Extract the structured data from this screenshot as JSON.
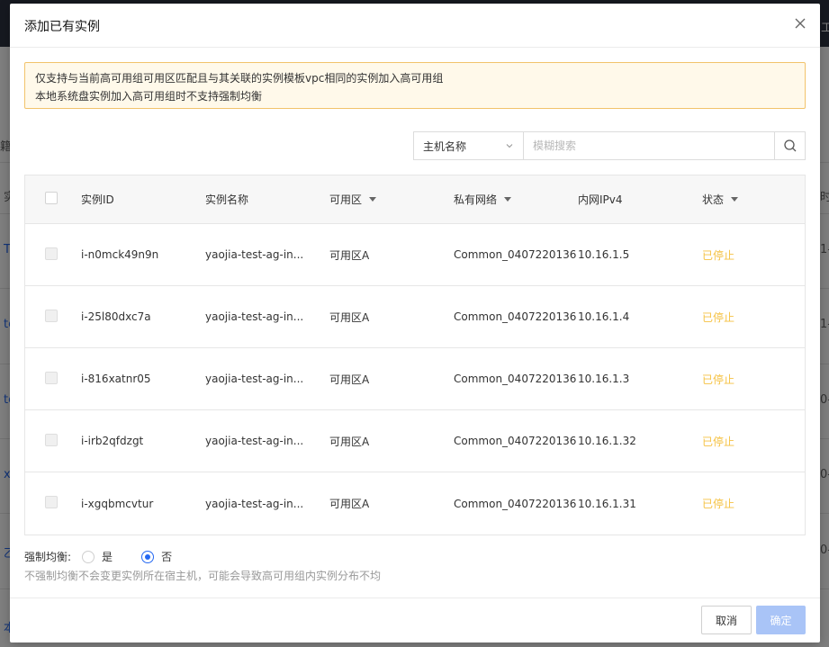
{
  "background": {
    "header_fragment": "工",
    "left_fragments": [
      "籍",
      "实",
      "T",
      "te",
      "te",
      "x",
      "乙",
      "本"
    ],
    "right_fragments": [
      "时",
      "1-",
      "1-",
      "0-",
      "0-",
      "0-"
    ]
  },
  "modal": {
    "title": "添加已有实例",
    "close_icon": "close-icon",
    "notice": [
      "仅支持与当前高可用组可用区匹配且与其关联的实例模板vpc相同的实例加入高可用组",
      "本地系统盘实例加入高可用组时不支持强制均衡"
    ],
    "search": {
      "select_value": "主机名称",
      "placeholder": "模糊搜索",
      "button_icon": "search-icon"
    },
    "table": {
      "columns": [
        "实例ID",
        "实例名称",
        "可用区",
        "私有网络",
        "内网IPv4",
        "状态"
      ],
      "rows": [
        {
          "id": "i-n0mck49n9n",
          "name": "yaojia-test-ag-in...",
          "zone": "可用区A",
          "vpc": "Common_0407220136",
          "ip": "10.16.1.5",
          "status": "已停止"
        },
        {
          "id": "i-25l80dxc7a",
          "name": "yaojia-test-ag-in...",
          "zone": "可用区A",
          "vpc": "Common_0407220136",
          "ip": "10.16.1.4",
          "status": "已停止"
        },
        {
          "id": "i-816xatnr05",
          "name": "yaojia-test-ag-in...",
          "zone": "可用区A",
          "vpc": "Common_0407220136",
          "ip": "10.16.1.3",
          "status": "已停止"
        },
        {
          "id": "i-irb2qfdzgt",
          "name": "yaojia-test-ag-in...",
          "zone": "可用区A",
          "vpc": "Common_0407220136",
          "ip": "10.16.1.32",
          "status": "已停止"
        },
        {
          "id": "i-xgqbmcvtur",
          "name": "yaojia-test-ag-in...",
          "zone": "可用区A",
          "vpc": "Common_0407220136",
          "ip": "10.16.1.31",
          "status": "已停止"
        }
      ]
    },
    "force_balance": {
      "label": "强制均衡:",
      "option_yes": "是",
      "option_no": "否",
      "selected": "否",
      "hint": "不强制均衡不会变更实例所在宿主机，可能会导致高可用组内实例分布不均"
    },
    "footer": {
      "cancel_label": "取消",
      "ok_label": "确定"
    },
    "colors": {
      "accent": "#2468f2",
      "status_stopped": "#f5c243",
      "notice_border": "#f2c36b",
      "notice_bg": "#fff9ea",
      "ok_disabled": "#a9c4f7"
    }
  }
}
